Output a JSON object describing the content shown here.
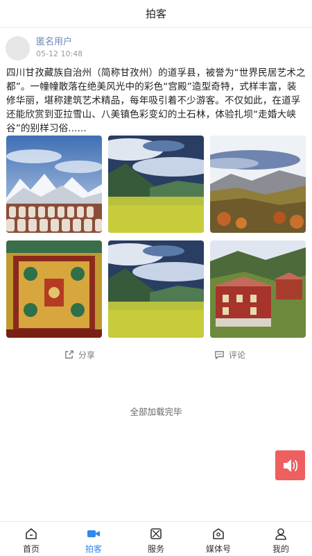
{
  "header": {
    "title": "拍客"
  },
  "post": {
    "username": "匿名用户",
    "timestamp": "05-12 10:48",
    "text": "四川甘孜藏族自治州（简称甘孜州）的道孚县，被誉为“世界民居艺术之都”。一幢幢散落在绝美风光中的彩色“宫殿”造型奇特，式样丰富，装修华丽，堪称建筑艺术精品，每年吸引着不少游客。不仅如此，在道孚还能欣赏到亚拉雪山、八美镇色彩变幻的土石林，体验扎坝“走婚大峡谷”的别样习俗......",
    "images": [
      {
        "icon": "snow-mountain-stupas-photo"
      },
      {
        "icon": "grassland-valley-photo"
      },
      {
        "icon": "autumn-valley-photo"
      },
      {
        "icon": "tibetan-wall-painting-photo"
      },
      {
        "icon": "grassland-valley-photo"
      },
      {
        "icon": "red-tibetan-houses-photo"
      }
    ],
    "actions": {
      "share": "分享",
      "comment": "评论"
    }
  },
  "footer_status": "全部加载完毕",
  "voice_button": {
    "icon": "speaker-icon",
    "color": "#ee5f5f"
  },
  "tabbar": {
    "active_color": "#2f87f0",
    "items": [
      {
        "label": "首页",
        "icon": "home-icon"
      },
      {
        "label": "拍客",
        "icon": "video-camera-icon"
      },
      {
        "label": "服务",
        "icon": "service-icon"
      },
      {
        "label": "媒体号",
        "icon": "media-icon"
      },
      {
        "label": "我的",
        "icon": "user-icon"
      }
    ]
  }
}
